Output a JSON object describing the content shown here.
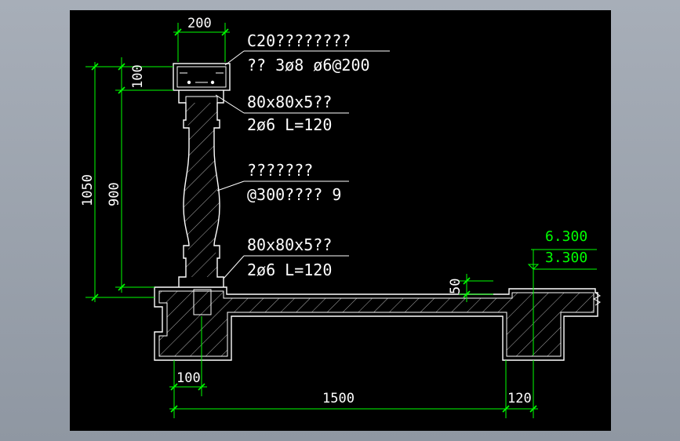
{
  "dimensions": {
    "rail_width": "200",
    "top_rail_height": "100",
    "total_height": "1050",
    "baluster_height": "900",
    "curb_height": "50",
    "curb_width": "100",
    "span": "1500",
    "beam_width": "120"
  },
  "levels": {
    "upper": "6.300",
    "lower": "3.300"
  },
  "labels": {
    "concrete_line1": "C20????????",
    "concrete_line2": "?? 3ø8 ø6@200",
    "embed_top_line1": "80x80x5??",
    "embed_top_line2": "2ø6 L=120",
    "baluster_line1": "???????",
    "baluster_line2": "@300???? 9",
    "embed_bot_line1": "80x80x5??",
    "embed_bot_line2": "2ø6 L=120"
  },
  "colors": {
    "background": "#000000",
    "dimension": "#00ff00",
    "linework": "#ffffff",
    "frame": "#9aa2ad"
  }
}
